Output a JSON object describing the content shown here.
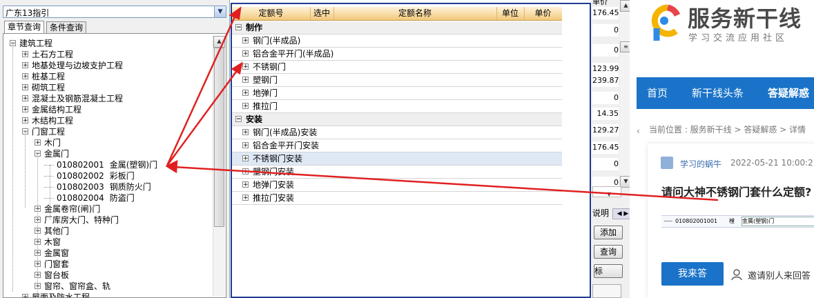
{
  "left": {
    "combo_value": "广东13指引",
    "tabs": [
      "章节查询",
      "条件查询"
    ],
    "tree": [
      {
        "label": "建筑工程",
        "toggle": "−"
      },
      {
        "label": "土石方工程",
        "toggle": "+"
      },
      {
        "label": "地基处理与边坡支护工程",
        "toggle": "+"
      },
      {
        "label": "桩基工程",
        "toggle": "+"
      },
      {
        "label": "砌筑工程",
        "toggle": "+"
      },
      {
        "label": "混凝土及钢筋混凝土工程",
        "toggle": "+"
      },
      {
        "label": "金属结构工程",
        "toggle": "+"
      },
      {
        "label": "木结构工程",
        "toggle": "+"
      },
      {
        "label": "门窗工程",
        "toggle": "−"
      },
      {
        "label": "木门",
        "toggle": "+"
      },
      {
        "label": "金属门",
        "toggle": "−"
      },
      {
        "code": "010802001",
        "label": "金属(塑钢)门"
      },
      {
        "code": "010802002",
        "label": "彩板门"
      },
      {
        "code": "010802003",
        "label": "钢质防火门"
      },
      {
        "code": "010802004",
        "label": "防盗门"
      },
      {
        "label": "金属卷帘(闸)门",
        "toggle": "+"
      },
      {
        "label": "厂库房大门、特种门",
        "toggle": "+"
      },
      {
        "label": "其他门",
        "toggle": "+"
      },
      {
        "label": "木窗",
        "toggle": "+"
      },
      {
        "label": "金属窗",
        "toggle": "+"
      },
      {
        "label": "门窗套",
        "toggle": "+"
      },
      {
        "label": "窗台板",
        "toggle": "+"
      },
      {
        "label": "窗帘、窗帘盒、轨",
        "toggle": "+"
      },
      {
        "label": "屋面及防水工程",
        "toggle": "+"
      }
    ]
  },
  "grid": {
    "headers": [
      "定额号",
      "选中",
      "定额名称",
      "单位",
      "单价"
    ],
    "rows": [
      {
        "label": "制作",
        "group": true,
        "toggle": "−"
      },
      {
        "label": "钢门(半成品)",
        "toggle": "+"
      },
      {
        "label": "铝合金平开门(半成品)",
        "toggle": "+"
      },
      {
        "label": "不锈钢门",
        "toggle": "+"
      },
      {
        "label": "塑钢门",
        "toggle": "+"
      },
      {
        "label": "地弹门",
        "toggle": "+"
      },
      {
        "label": "推拉门",
        "toggle": "+"
      },
      {
        "label": "安装",
        "group": true,
        "toggle": "−"
      },
      {
        "label": "钢门(半成品)安装",
        "toggle": "+"
      },
      {
        "label": "铝合金平开门安装",
        "toggle": "+"
      },
      {
        "label": "不锈钢门安装",
        "toggle": "+",
        "selected": true
      },
      {
        "label": "塑钢门安装",
        "toggle": "+"
      },
      {
        "label": "地弹门安装",
        "toggle": "+"
      },
      {
        "label": "推拉门安装",
        "toggle": "+"
      }
    ]
  },
  "right_window": {
    "header_fragment": "单价",
    "numbers": [
      "176.45",
      "0",
      "0",
      "123.99",
      "239.87",
      "0",
      "14.35",
      "129.27",
      "176.45",
      "0",
      "0"
    ],
    "note_label": "说明",
    "add_button": "添加",
    "query_button": "查询",
    "frag_label": "标"
  },
  "web": {
    "brand": "服务新干线",
    "slogan": "学习交流应用社区",
    "nav": [
      "首页",
      "新干线头条",
      "答疑解惑"
    ],
    "breadcrumb": "当前位置 : 服务新干线 > 答疑解惑 > 详情",
    "author": "学习的蜗牛",
    "date": "2022-05-21 10:00:27",
    "question": "请问大神不锈钢门套什么定额?",
    "thumb_code": "010802001001",
    "thumb_unit": "樘",
    "thumb_name": "金属(塑钢)门",
    "answer_button": "我来答",
    "invite": "邀请别人来回答"
  },
  "colors": {
    "accent_blue": "#1a73c8",
    "popup_border": "#1f3a93",
    "arrow_red": "#e02020",
    "header_orange": "#f2c87a"
  }
}
